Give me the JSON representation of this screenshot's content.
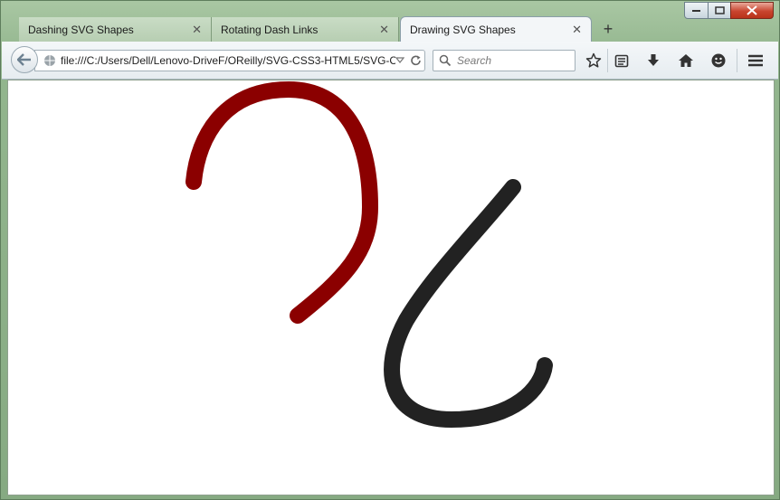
{
  "tabs": [
    {
      "label": "Dashing SVG Shapes",
      "active": false
    },
    {
      "label": "Rotating Dash Links",
      "active": false
    },
    {
      "label": "Drawing SVG Shapes",
      "active": true
    }
  ],
  "toolbar": {
    "url": "file:///C:/Users/Dell/Lenovo-DriveF/OReilly/SVG-CSS3-HTML5/SVG-C",
    "search_placeholder": "Search"
  },
  "colors": {
    "red_stroke": "#8b0000",
    "dark_stroke": "#222222"
  },
  "icons": [
    "back-arrow-icon",
    "globe-icon",
    "dropdown-icon",
    "reload-icon",
    "search-icon",
    "star-icon",
    "reading-list-icon",
    "download-icon",
    "home-icon",
    "smiley-icon",
    "menu-icon"
  ]
}
